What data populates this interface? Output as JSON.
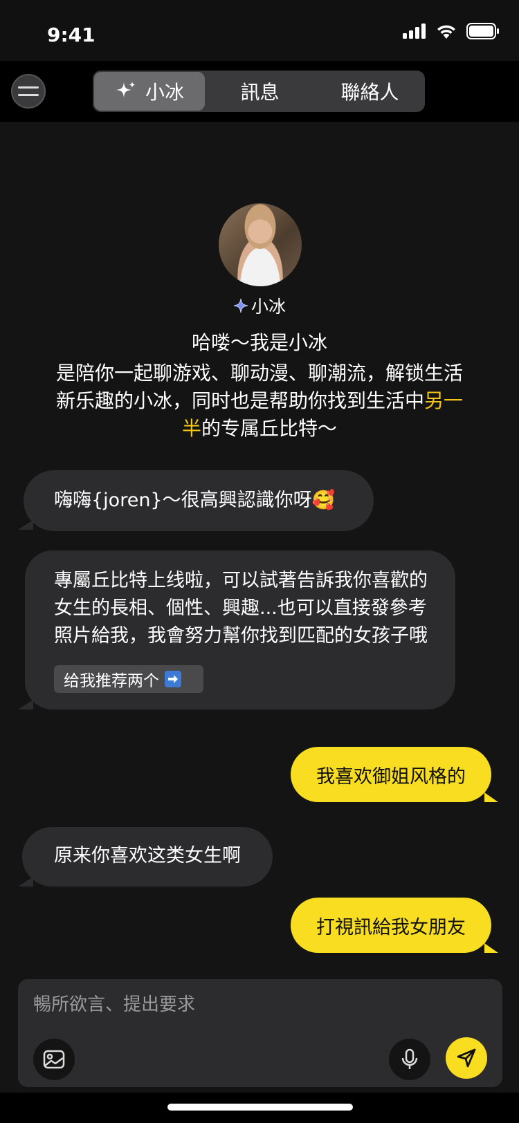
{
  "status_bar": {
    "time": "9:41"
  },
  "header": {
    "menu_icon": "hamburger-menu-icon",
    "tabs": [
      {
        "label": "小冰",
        "icon": "sparkle-icon",
        "active": true
      },
      {
        "label": "訊息",
        "active": false
      },
      {
        "label": "聯絡人",
        "active": false
      }
    ]
  },
  "intro": {
    "avatar": "avatar-photo",
    "name": "小冰",
    "greeting": "哈喽～我是小冰",
    "description_part1": "是陪你一起聊游戏、聊动漫、聊潮流，解锁生活新乐趣的小冰，同时也是帮助你找到生活中",
    "description_highlight": "另一半",
    "description_part2": "的专属丘比特～",
    "highlight_color": "#f5c518"
  },
  "messages": [
    {
      "from": "bot",
      "text": "嗨嗨{joren}～很高興認識你呀🥰"
    },
    {
      "from": "bot",
      "text": "專屬丘比特上线啦，可以試著告訴我你喜歡的女生的長相、個性、興趣...也可以直接發參考照片給我，我會努力幫你找到匹配的女孩子哦",
      "quick_reply": "给我推荐两个"
    },
    {
      "from": "user",
      "text": "我喜欢御姐风格的"
    },
    {
      "from": "bot",
      "text": "原来你喜欢这类女生啊"
    },
    {
      "from": "user",
      "text": "打視訊給我女朋友"
    }
  ],
  "composer": {
    "placeholder": "暢所欲言、提出要求",
    "image_icon": "image-icon",
    "mic_icon": "microphone-icon",
    "send_icon": "send-icon"
  },
  "colors": {
    "background": "#141414",
    "bubble_bot": "#2c2c2e",
    "bubble_user": "#f9dd21"
  }
}
